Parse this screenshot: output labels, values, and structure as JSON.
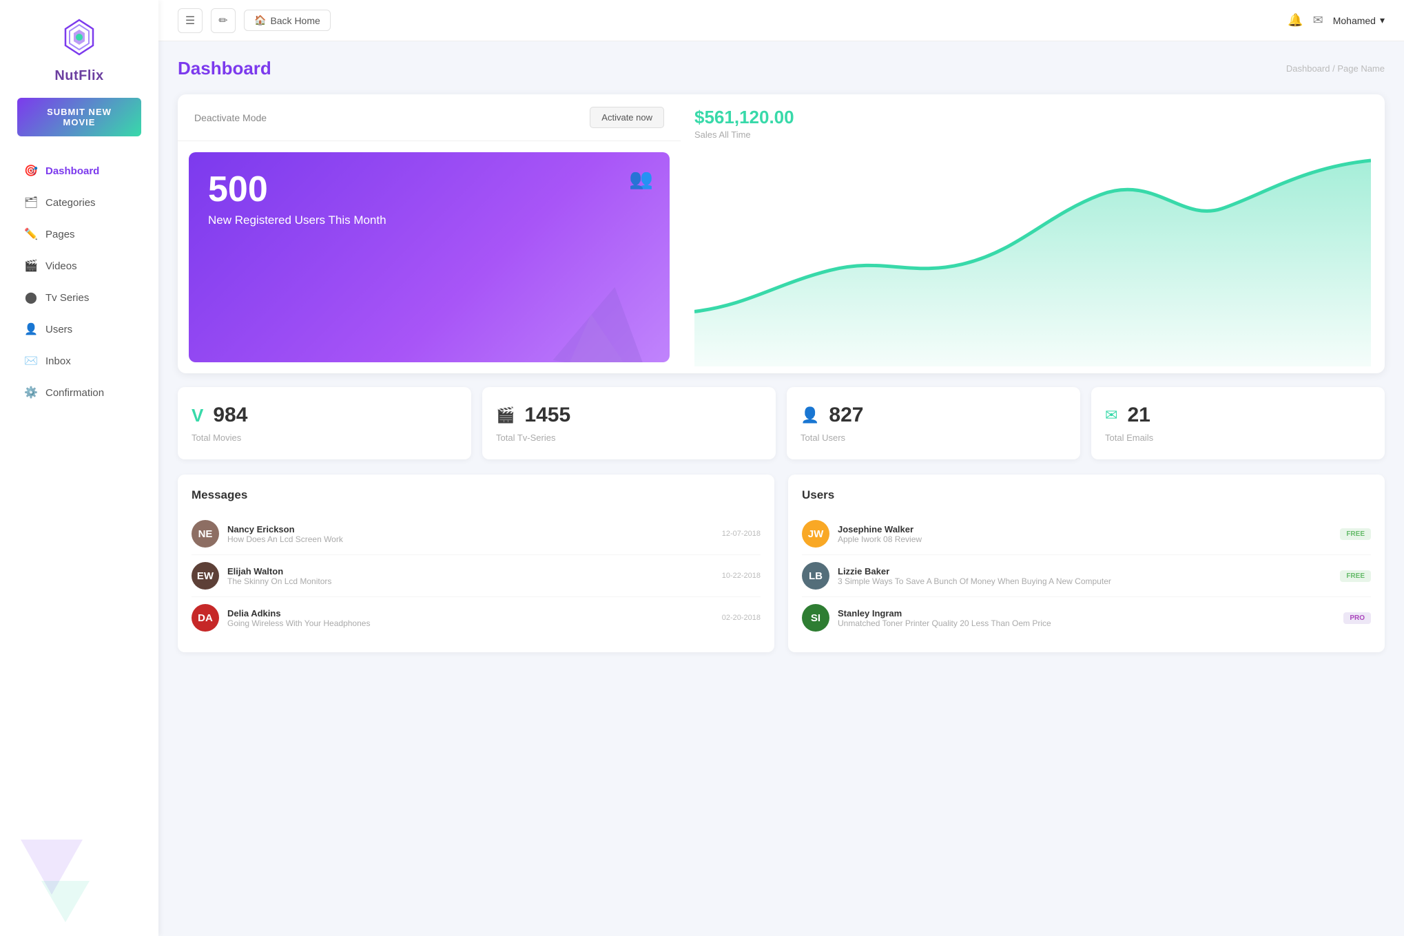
{
  "sidebar": {
    "brand": "NutFlix",
    "submit_btn": "SUBMIT NEW MOVIE",
    "nav_items": [
      {
        "label": "Dashboard",
        "icon": "🎯",
        "active": true
      },
      {
        "label": "Categories",
        "icon": "🗂"
      },
      {
        "label": "Pages",
        "icon": "✏️"
      },
      {
        "label": "Videos",
        "icon": "🎬"
      },
      {
        "label": "Tv Series",
        "icon": "⬤"
      },
      {
        "label": "Users",
        "icon": "👤"
      },
      {
        "label": "Inbox",
        "icon": "✉️"
      },
      {
        "label": "Confirmation",
        "icon": "⚙️"
      }
    ]
  },
  "topbar": {
    "menu_icon": "☰",
    "edit_icon": "✏",
    "home_icon": "🏠",
    "back_home": "Back Home",
    "notification_icon": "🔔",
    "mail_icon": "✉",
    "user_name": "Mohamed",
    "dropdown_icon": "▾"
  },
  "page": {
    "title": "Dashboard",
    "breadcrumb1": "Dashboard",
    "breadcrumb2": "Page Name"
  },
  "stats_top": {
    "deactivate_label": "Deactivate Mode",
    "activate_btn": "Activate now",
    "sales_amount": "$561,120.00",
    "sales_label": "Sales All Time",
    "new_users_number": "500",
    "new_users_label": "New Registered Users This Month"
  },
  "stat_cards": [
    {
      "icon": "V",
      "icon_class": "green",
      "number": "984",
      "label": "Total Movies"
    },
    {
      "icon": "🎬",
      "icon_class": "teal",
      "number": "1455",
      "label": "Total Tv-Series"
    },
    {
      "icon": "👤",
      "icon_class": "purple",
      "number": "827",
      "label": "Total Users"
    },
    {
      "icon": "✉",
      "icon_class": "mint",
      "number": "21",
      "label": "Total Emails"
    }
  ],
  "messages": {
    "section_title": "Messages",
    "items": [
      {
        "name": "Nancy Erickson",
        "sub": "How Does An Lcd Screen Work",
        "date": "12-07-2018",
        "color": "#8d6e63",
        "initials": "NE"
      },
      {
        "name": "Elijah Walton",
        "sub": "The Skinny On Lcd Monitors",
        "date": "10-22-2018",
        "color": "#5d4037",
        "initials": "EW"
      },
      {
        "name": "Delia Adkins",
        "sub": "Going Wireless With Your Headphones",
        "date": "02-20-2018",
        "color": "#c62828",
        "initials": "DA"
      }
    ]
  },
  "users": {
    "section_title": "Users",
    "items": [
      {
        "name": "Josephine Walker",
        "sub": "Apple Iwork 08 Review",
        "badge": "FREE",
        "badge_type": "free",
        "color": "#f9a825",
        "initials": "JW"
      },
      {
        "name": "Lizzie Baker",
        "sub": "3 Simple Ways To Save A Bunch Of Money When Buying A New Computer",
        "badge": "FREE",
        "badge_type": "free",
        "color": "#546e7a",
        "initials": "LB"
      },
      {
        "name": "Stanley Ingram",
        "sub": "Unmatched Toner Printer Quality 20 Less Than Oem Price",
        "badge": "PRO",
        "badge_type": "pro",
        "color": "#2e7d32",
        "initials": "SI"
      }
    ]
  }
}
